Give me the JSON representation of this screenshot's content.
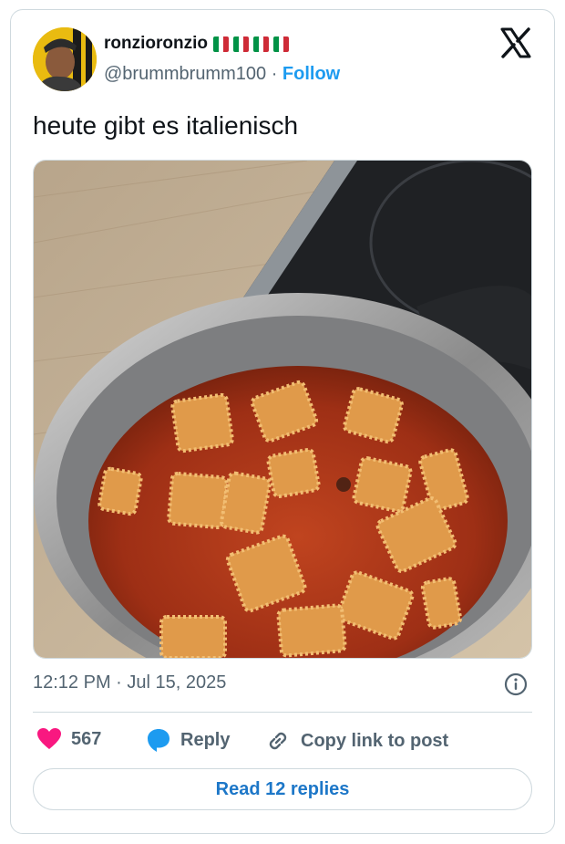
{
  "author": {
    "display_name": "ronzioronzio",
    "flags": [
      "flag-italy",
      "flag-italy",
      "flag-italy",
      "flag-italy"
    ],
    "handle": "@brummbrumm100",
    "separator": "·",
    "follow_label": "Follow"
  },
  "tweet": {
    "text": "heute gibt es italienisch",
    "timestamp": "12:12 PM · Jul 15, 2025"
  },
  "actions": {
    "like_count": "567",
    "reply_label": "Reply",
    "copy_link_label": "Copy link to post"
  },
  "read_replies_label": "Read 12 replies",
  "icons": {
    "brand": "x-logo-icon",
    "info": "info-icon",
    "like": "heart-icon",
    "reply": "speech-bubble-icon",
    "copy": "link-icon"
  },
  "colors": {
    "like": "#f91880",
    "reply": "#1d9bf0",
    "follow": "#1d9bf0",
    "secondary_text": "#536471",
    "border": "#cfd9de"
  }
}
